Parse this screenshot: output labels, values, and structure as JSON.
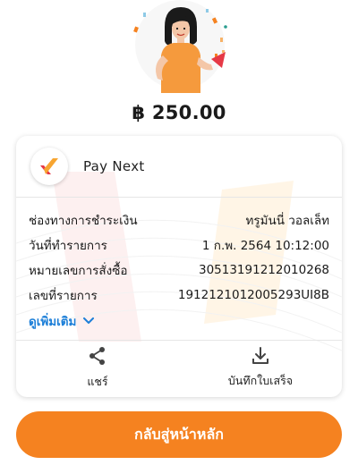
{
  "amount": "฿ 250.00",
  "merchant": {
    "name": "Pay Next",
    "logo_icon": "paynext-logo-icon"
  },
  "details": [
    {
      "label": "ช่องทางการชำระเงิน",
      "value": "ทรูมันนี่ วอลเล็ท"
    },
    {
      "label": "วันที่ทำรายการ",
      "value": "1 ก.พ. 2564  10:12:00"
    },
    {
      "label": "หมายเลขการสั่งซื้อ",
      "value": "30513191212010268"
    },
    {
      "label": "เลขที่รายการ",
      "value": "1912121012005293UI8B"
    }
  ],
  "more_label": "ดูเพิ่มเติม",
  "actions": {
    "share": "แชร์",
    "save_receipt": "บันทึกใบเสร็จ"
  },
  "home_button": "กลับสู่หน้าหลัก",
  "colors": {
    "accent": "#f58220",
    "link": "#1d7fd8"
  }
}
